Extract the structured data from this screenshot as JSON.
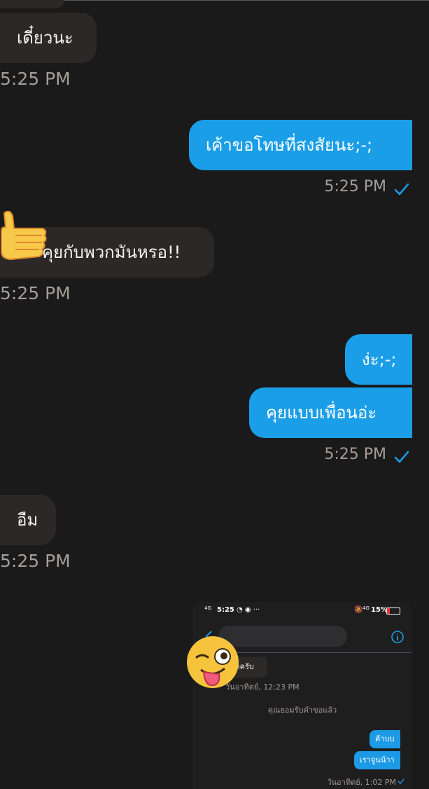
{
  "messages": [
    {
      "dir": "in",
      "text": "เดี๋ยวนะ",
      "time": "5:25 PM"
    },
    {
      "dir": "out",
      "text": "เค้าขอโทษที่สงสัยนะ;-;",
      "time": "5:25 PM"
    },
    {
      "dir": "in",
      "text": "คุยกับพวกมันหรอ!!",
      "time": "5:25 PM"
    },
    {
      "dir": "out",
      "text": "ง่ะ;-;"
    },
    {
      "dir": "out",
      "text": "คุยแบบเพื่อนอ่ะ",
      "time": "5:25 PM"
    },
    {
      "dir": "in",
      "text": "อืม",
      "time": "5:25 PM"
    }
  ],
  "embedded": {
    "status_time": "5:25",
    "status_network": "4G",
    "battery": "15%",
    "net_right": "4G",
    "msg_in": "กครับ",
    "time_in": "วันอาทิตย์, 12:23 PM",
    "system_note": "คุณยอมรับคำขอแล้ว",
    "msg_out_1": "ค้าบบ",
    "msg_out_2": "เราจูนน้าา",
    "time_out": "วันอาทิตย์, 1:02 PM"
  },
  "colors": {
    "bg": "#1a1a1b",
    "bubble_in": "#2b2827",
    "bubble_out": "#1b9ee8",
    "check": "#1b9ee8"
  }
}
